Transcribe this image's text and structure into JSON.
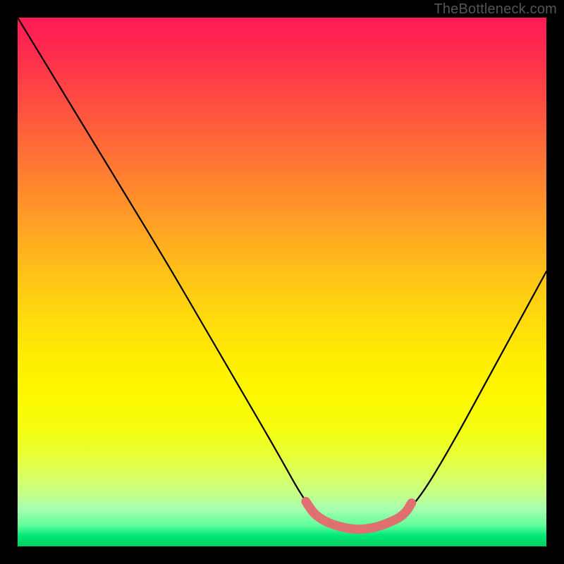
{
  "attribution": "TheBottleneck.com",
  "chart_data": {
    "type": "line",
    "title": "",
    "xlabel": "",
    "ylabel": "",
    "xlim": [
      0,
      100
    ],
    "ylim": [
      0,
      100
    ],
    "series": [
      {
        "name": "bottleneck-curve",
        "x": [
          0,
          7,
          14,
          21,
          28,
          35,
          42,
          49,
          54,
          57,
          61,
          65,
          69,
          72,
          76,
          82,
          88,
          94,
          100
        ],
        "values": [
          100,
          88.5,
          77,
          65.5,
          54,
          42,
          30,
          18,
          9,
          5.5,
          3.8,
          3.2,
          3.6,
          5.2,
          9,
          19,
          30,
          41,
          52
        ]
      }
    ],
    "marker_segment": {
      "comment": "Thick rosy segment near the minimum",
      "x": [
        54.5,
        56,
        58,
        60,
        62,
        64,
        66,
        68,
        70,
        72,
        73.5,
        74.5
      ],
      "values": [
        8.5,
        6.2,
        4.8,
        4.0,
        3.5,
        3.2,
        3.3,
        3.7,
        4.4,
        5.3,
        6.5,
        8.2
      ]
    },
    "gradient_stops": [
      {
        "pct": 0,
        "color": "#ff1a55"
      },
      {
        "pct": 50,
        "color": "#ffd000"
      },
      {
        "pct": 100,
        "color": "#00d060"
      }
    ]
  }
}
